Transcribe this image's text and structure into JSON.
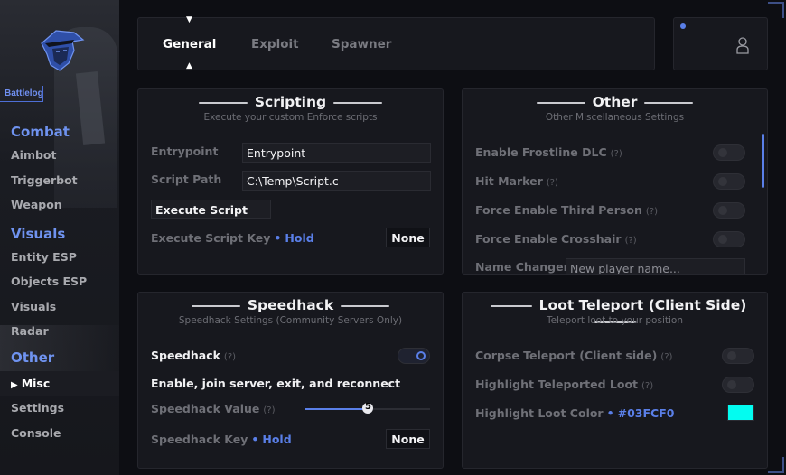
{
  "brand": {
    "name": "Battlelog"
  },
  "sidebar": {
    "sections": [
      {
        "category": "Combat",
        "items": [
          "Aimbot",
          "Triggerbot",
          "Weapon"
        ]
      },
      {
        "category": "Visuals",
        "items": [
          "Entity ESP",
          "Objects ESP",
          "Visuals",
          "Radar"
        ]
      },
      {
        "category": "Other",
        "items": [
          "Misc",
          "Settings",
          "Console"
        ]
      }
    ],
    "active_item": "Misc"
  },
  "tabs": {
    "items": [
      "General",
      "Exploit",
      "Spawner"
    ],
    "active": "General"
  },
  "scripting": {
    "title": "Scripting",
    "subtitle": "Execute your custom Enforce scripts",
    "entrypoint_label": "Entrypoint",
    "entrypoint_value": "Entrypoint",
    "script_path_label": "Script Path",
    "script_path_value": "C:\\Temp\\Script.c",
    "execute_button": "Execute Script",
    "key_label": "Execute Script Key",
    "key_mode": "Hold",
    "key_value": "None"
  },
  "other": {
    "title": "Other",
    "subtitle": "Other Miscellaneous Settings",
    "help": "(?)",
    "toggles": [
      {
        "label": "Enable Frostline DLC",
        "on": false
      },
      {
        "label": "Hit Marker",
        "on": false
      },
      {
        "label": "Force Enable Third Person",
        "on": false
      },
      {
        "label": "Force Enable Crosshair",
        "on": false
      }
    ],
    "name_changer_label": "Name Changer",
    "name_changer_placeholder": "New player name..."
  },
  "speedhack": {
    "title": "Speedhack",
    "subtitle": "Speedhack Settings (Community Servers Only)",
    "toggle_label": "Speedhack",
    "toggle_on": true,
    "help": "(?)",
    "note": "Enable, join server, exit, and reconnect",
    "value_label": "Speedhack Value",
    "value": "5",
    "value_fraction": 0.5,
    "key_label": "Speedhack Key",
    "key_mode": "Hold",
    "key_value": "None"
  },
  "loot": {
    "title": "Loot Teleport (Client Side)",
    "subtitle": "Teleport loot to your position",
    "help": "(?)",
    "toggles": [
      {
        "label": "Corpse Teleport (Client side)",
        "on": false
      },
      {
        "label": "Highlight Teleported Loot",
        "on": false
      }
    ],
    "color_label": "Highlight Loot Color",
    "color_value": "#03FCF0"
  },
  "colors": {
    "accent": "#5a7fe8",
    "loot_color": "#03FCF0",
    "background": "#0d0e13",
    "panel": "#17181e"
  }
}
